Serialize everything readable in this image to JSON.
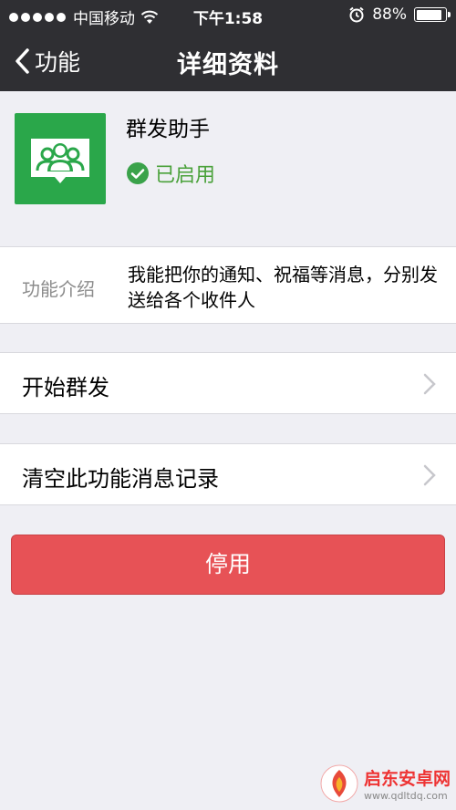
{
  "status_bar": {
    "carrier": "中国移动",
    "time": "下午1:58",
    "battery": "88%",
    "battery_level": 0.88
  },
  "nav": {
    "back_label": "功能",
    "title": "详细资料"
  },
  "profile": {
    "name": "群发助手",
    "status": "已启用",
    "icon": "group-chat-icon"
  },
  "intro": {
    "label": "功能介绍",
    "text": "我能把你的通知、祝福等消息，分别发送给各个收件人"
  },
  "rows": [
    {
      "label": "开始群发"
    },
    {
      "label": "清空此功能消息记录"
    }
  ],
  "stop_button": "停用",
  "watermark": {
    "name": "启东安卓网",
    "url": "www.qdltdq.com"
  },
  "colors": {
    "nav_bg": "#2f2f33",
    "app_green": "#2aa74a",
    "status_green": "#4aa13a",
    "danger": "#e75256"
  }
}
